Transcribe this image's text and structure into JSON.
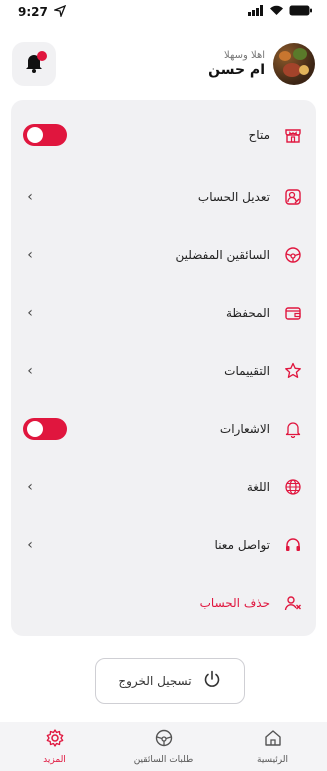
{
  "status_bar": {
    "time": "9:27"
  },
  "header": {
    "greeting": "اهلا وسهلا",
    "username": "ام حسن"
  },
  "menu": {
    "items": [
      {
        "label": "متاح",
        "icon": "store-icon",
        "control": "toggle",
        "toggle_on": true
      },
      {
        "label": "تعديل الحساب",
        "icon": "edit-account-icon",
        "control": "chevron"
      },
      {
        "label": "السائقين المفضلين",
        "icon": "steering-wheel-icon",
        "control": "chevron"
      },
      {
        "label": "المحفظة",
        "icon": "wallet-icon",
        "control": "chevron"
      },
      {
        "label": "التقييمات",
        "icon": "star-icon",
        "control": "chevron"
      },
      {
        "label": "الاشعارات",
        "icon": "bell-icon",
        "control": "toggle",
        "toggle_on": true
      },
      {
        "label": "اللغة",
        "icon": "globe-icon",
        "control": "chevron"
      },
      {
        "label": "تواصل معنا",
        "icon": "headset-icon",
        "control": "chevron"
      },
      {
        "label": "حذف الحساب",
        "icon": "delete-user-icon",
        "control": "none",
        "danger": true
      }
    ]
  },
  "logout": {
    "label": "تسجيل الخروج",
    "icon": "power-icon"
  },
  "bottom_nav": {
    "items": [
      {
        "label": "الرئيسية",
        "icon": "home-icon",
        "active": false
      },
      {
        "label": "طلبات السائقين",
        "icon": "steering-wheel-icon",
        "active": false
      },
      {
        "label": "المزيد",
        "icon": "gear-icon",
        "active": true
      }
    ]
  },
  "colors": {
    "accent": "#e0163e",
    "card_bg": "#f1f1f3",
    "text": "#222222"
  }
}
